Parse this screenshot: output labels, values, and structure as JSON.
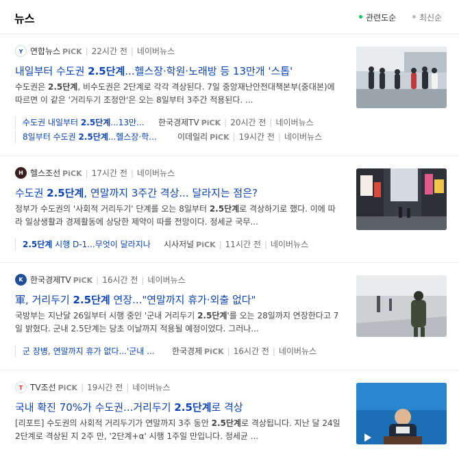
{
  "header": {
    "title": "뉴스",
    "sort_relevance": "관련도순",
    "sort_recent": "최신순"
  },
  "colors": {
    "accent": "#03c75a",
    "link": "#0c43b7"
  },
  "articles": [
    {
      "press": "연합뉴스",
      "pick": "PiCK",
      "time": "22시간 전",
      "portal": "네이버뉴스",
      "headline_pre": "내일부터 수도권 ",
      "headline_bold": "2.5단계",
      "headline_post": "...헬스장·학원·노래방 등 13만개 '스톱'",
      "desc_a": "수도권은 ",
      "desc_bold": "2.5단계",
      "desc_b": ", 비수도권은 2단계로 각각 격상된다. 7일 중앙재난안전대책본부(중대본)에 따르면 이 같은 '거리두기 조정안'은 오는 8일부터 3주간 적용된다. ...",
      "thumb_icon": "queue-photo",
      "related": [
        {
          "pre": "수도권 내일부터 ",
          "bold": "2.5단계",
          "post": "...13만...",
          "src": "한국경제TV",
          "pick": "PiCK",
          "time": "20시간 전",
          "portal": "네이버뉴스"
        },
        {
          "pre": "8일부터 수도권 ",
          "bold": "2.5단계",
          "post": "...헬스장·학...",
          "src": "이데일리",
          "pick": "PiCK",
          "time": "19시간 전",
          "portal": "네이버뉴스"
        }
      ]
    },
    {
      "press": "헬스조선",
      "pick": "PiCK",
      "time": "17시간 전",
      "portal": "네이버뉴스",
      "headline_pre": "수도권 ",
      "headline_bold": "2.5단계",
      "headline_post": ", 연말까지 3주간 격상... 달라지는 점은?",
      "desc_a": "정부가 수도권의 '사회적 거리두기' 단계를 오는 8일부터 ",
      "desc_bold": "2.5단계",
      "desc_b": "로 격상하기로 했다. 이에 따라 일상생활과 경제활동에 상당한 제약이 따를 전망이다. 정세균 국무...",
      "thumb_icon": "street-photo",
      "related": [
        {
          "pre": "",
          "bold": "2.5단계",
          "post": " 시행 D-1...무엇이 달라지나",
          "src": "시사저널",
          "pick": "PiCK",
          "time": "11시간 전",
          "portal": "네이버뉴스"
        }
      ]
    },
    {
      "press": "한국경제TV",
      "pick": "PiCK",
      "time": "16시간 전",
      "portal": "네이버뉴스",
      "headline_pre": "軍, 거리두기 ",
      "headline_bold": "2.5단계",
      "headline_post": " 연장...\"연말까지 휴가·외출 없다\"",
      "desc_a": "국방부는 지난달 26일부터 시행 중인 '군내 거리두기 ",
      "desc_bold": "2.5단계",
      "desc_b": "'를 오는 28일까지 연장한다고 7일 밝혔다. 군내 2.5단계는 당초 이날까지 적용될 예정이었다. 그러나...",
      "thumb_icon": "soldier-photo",
      "related": [
        {
          "pre": "군 장병, 연말까지 휴가 없다...'군내 ...",
          "bold": "",
          "post": "",
          "src": "한국경제",
          "pick": "PiCK",
          "time": "16시간 전",
          "portal": "네이버뉴스"
        }
      ]
    },
    {
      "press": "TV조선",
      "pick": "PiCK",
      "time": "19시간 전",
      "portal": "네이버뉴스",
      "headline_pre": "국내 확진 70%가 수도권...거리두기 ",
      "headline_bold": "2.5단계",
      "headline_post": "로 격상",
      "desc_a": "[리포트] 수도권의 사회적 거리두기가 연말까지 3주 동안 ",
      "desc_bold": "2.5단계",
      "desc_b": "로 격상됩니다. 지난 달 24일 2단계로 격상된 지 2주 만, '2단계+α' 시행 1주일 만입니다. 정세균 ...",
      "thumb_icon": "briefing-video",
      "related": []
    }
  ]
}
